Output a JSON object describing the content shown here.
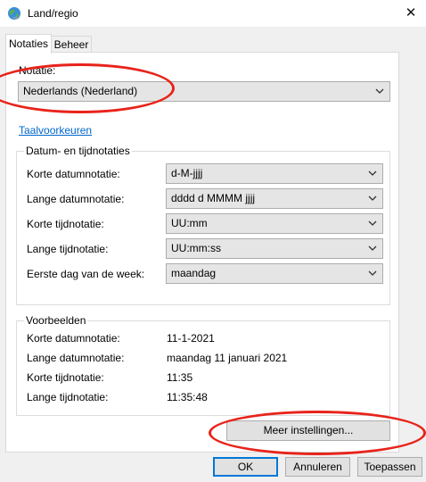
{
  "window": {
    "title": "Land/regio",
    "close_glyph": "✕",
    "app_icon": "globe-icon"
  },
  "tabs": [
    {
      "label": "Notaties",
      "active": true
    },
    {
      "label": "Beheer",
      "active": false
    }
  ],
  "notation": {
    "label": "Notatie:",
    "value": "Nederlands (Nederland)",
    "language_prefs_link": "Taalvoorkeuren"
  },
  "formats": {
    "caption": "Datum- en tijdnotaties",
    "rows": [
      {
        "label": "Korte datumnotatie:",
        "value": "d-M-jjjj"
      },
      {
        "label": "Lange datumnotatie:",
        "value": "dddd d MMMM jjjj"
      },
      {
        "label": "Korte tijdnotatie:",
        "value": "UU:mm"
      },
      {
        "label": "Lange tijdnotatie:",
        "value": "UU:mm:ss"
      },
      {
        "label": "Eerste dag van de week:",
        "value": "maandag"
      }
    ]
  },
  "examples": {
    "caption": "Voorbeelden",
    "rows": [
      {
        "label": "Korte datumnotatie:",
        "value": "11-1-2021"
      },
      {
        "label": "Lange datumnotatie:",
        "value": "maandag 11 januari 2021"
      },
      {
        "label": "Korte tijdnotatie:",
        "value": "11:35"
      },
      {
        "label": "Lange tijdnotatie:",
        "value": "11:35:48"
      }
    ]
  },
  "buttons": {
    "more_settings": "Meer instellingen...",
    "ok": "OK",
    "cancel": "Annuleren",
    "apply": "Toepassen"
  },
  "colors": {
    "highlight_ellipse": "#e8231a",
    "link": "#0066cc",
    "default_button_border": "#0078d7"
  }
}
